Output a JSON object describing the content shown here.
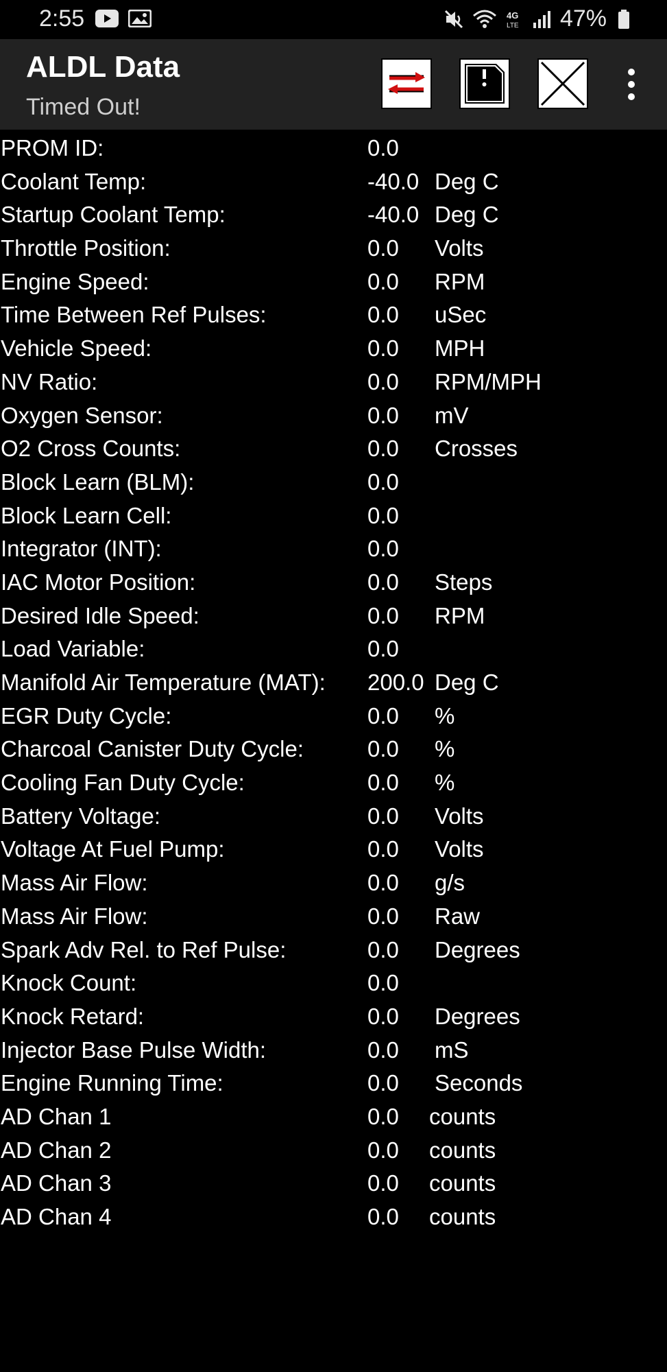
{
  "status_bar": {
    "time": "2:55",
    "battery": "47%",
    "icons": [
      "youtube-icon",
      "gallery-icon",
      "mute-icon",
      "wifi-icon",
      "4g-lte-icon",
      "signal-icon",
      "battery-icon"
    ]
  },
  "app_bar": {
    "title": "ALDL Data",
    "subtitle": "Timed Out!",
    "actions": [
      "connect-arrows-icon",
      "save-disk-icon",
      "close-x-icon",
      "overflow-menu-icon"
    ]
  },
  "rows": [
    {
      "label": "PROM ID:",
      "value": "0.0",
      "unit": ""
    },
    {
      "label": "Coolant Temp:",
      "value": "-40.0",
      "unit": "Deg C"
    },
    {
      "label": "Startup Coolant Temp:",
      "value": "-40.0",
      "unit": "Deg C"
    },
    {
      "label": "Throttle Position:",
      "value": "0.0",
      "unit": "Volts"
    },
    {
      "label": "Engine Speed:",
      "value": "0.0",
      "unit": "RPM"
    },
    {
      "label": "Time Between Ref Pulses:",
      "value": "0.0",
      "unit": "uSec"
    },
    {
      "label": "Vehicle Speed:",
      "value": "0.0",
      "unit": "MPH"
    },
    {
      "label": "NV Ratio:",
      "value": "0.0",
      "unit": "RPM/MPH"
    },
    {
      "label": "Oxygen Sensor:",
      "value": "0.0",
      "unit": "mV"
    },
    {
      "label": "O2 Cross Counts:",
      "value": "0.0",
      "unit": "Crosses"
    },
    {
      "label": "Block Learn (BLM):",
      "value": "0.0",
      "unit": ""
    },
    {
      "label": "Block Learn Cell:",
      "value": "0.0",
      "unit": ""
    },
    {
      "label": "Integrator (INT):",
      "value": "0.0",
      "unit": ""
    },
    {
      "label": "IAC Motor Position:",
      "value": "0.0",
      "unit": "Steps"
    },
    {
      "label": "Desired Idle Speed:",
      "value": "0.0",
      "unit": "RPM"
    },
    {
      "label": "Load Variable:",
      "value": "0.0",
      "unit": ""
    },
    {
      "label": "Manifold Air Temperature (MAT):",
      "value": "200.0",
      "unit": "Deg C"
    },
    {
      "label": "EGR Duty Cycle:",
      "value": "0.0",
      "unit": "%"
    },
    {
      "label": "Charcoal Canister Duty Cycle:",
      "value": "0.0",
      "unit": "%"
    },
    {
      "label": "Cooling Fan Duty Cycle:",
      "value": "0.0",
      "unit": "%"
    },
    {
      "label": "Battery Voltage:",
      "value": "0.0",
      "unit": "Volts"
    },
    {
      "label": "Voltage At Fuel Pump:",
      "value": "0.0",
      "unit": "Volts"
    },
    {
      "label": "Mass Air Flow:",
      "value": "0.0",
      "unit": "g/s"
    },
    {
      "label": "Mass Air Flow:",
      "value": "0.0",
      "unit": "Raw"
    },
    {
      "label": "Spark Adv Rel. to Ref Pulse:",
      "value": "0.0",
      "unit": "Degrees"
    },
    {
      "label": "Knock Count:",
      "value": "0.0",
      "unit": ""
    },
    {
      "label": "Knock Retard:",
      "value": "0.0",
      "unit": "Degrees"
    },
    {
      "label": "Injector Base Pulse Width:",
      "value": "0.0",
      "unit": "mS"
    },
    {
      "label": "Engine Running Time:",
      "value": "0.0",
      "unit": "Seconds"
    },
    {
      "label": "AD Chan 1",
      "value": "0.0",
      "unit": "counts"
    },
    {
      "label": "AD Chan 2",
      "value": "0.0",
      "unit": "counts"
    },
    {
      "label": "AD Chan 3",
      "value": "0.0",
      "unit": "counts"
    },
    {
      "label": "AD Chan 4",
      "value": "0.0",
      "unit": "counts"
    }
  ]
}
